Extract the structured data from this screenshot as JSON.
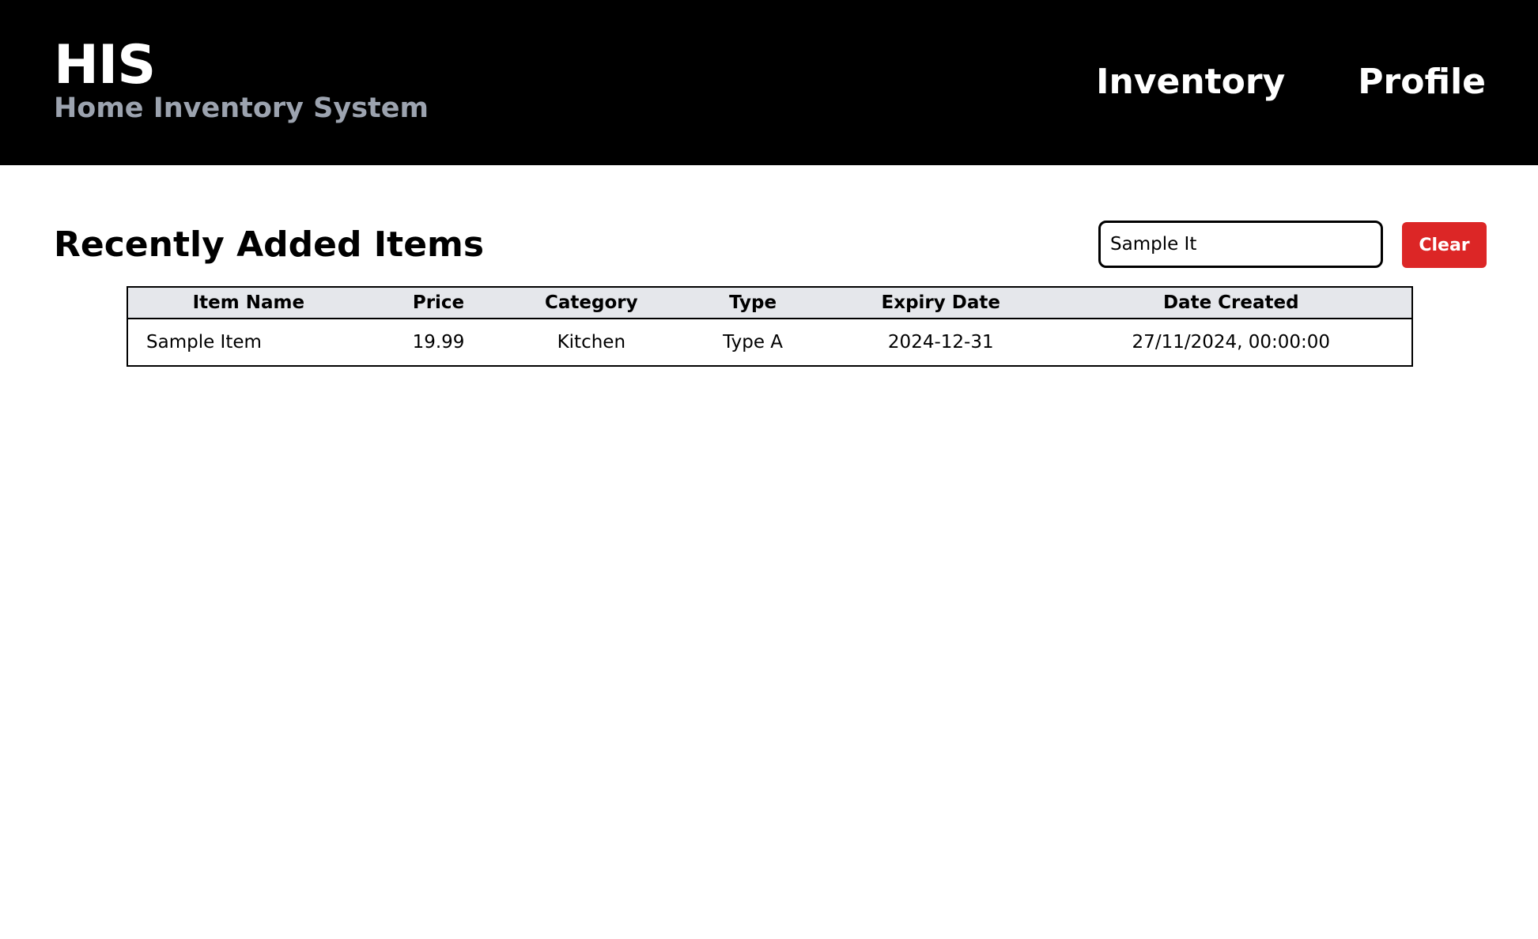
{
  "header": {
    "title": "HIS",
    "subtitle": "Home Inventory System",
    "nav": [
      {
        "label": "Inventory"
      },
      {
        "label": "Profile"
      }
    ]
  },
  "main": {
    "title": "Recently Added Items",
    "search": {
      "value": "Sample It"
    },
    "clear_label": "Clear",
    "table": {
      "columns": [
        "Item Name",
        "Price",
        "Category",
        "Type",
        "Expiry Date",
        "Date Created"
      ],
      "rows": [
        [
          "Sample Item",
          "19.99",
          "Kitchen",
          "Type A",
          "2024-12-31",
          "27/11/2024, 00:00:00"
        ]
      ]
    }
  },
  "colors": {
    "header_bg": "#000000",
    "subtitle": "#9ca3af",
    "clear_button": "#dc2626",
    "table_header_bg": "#e5e7eb"
  }
}
